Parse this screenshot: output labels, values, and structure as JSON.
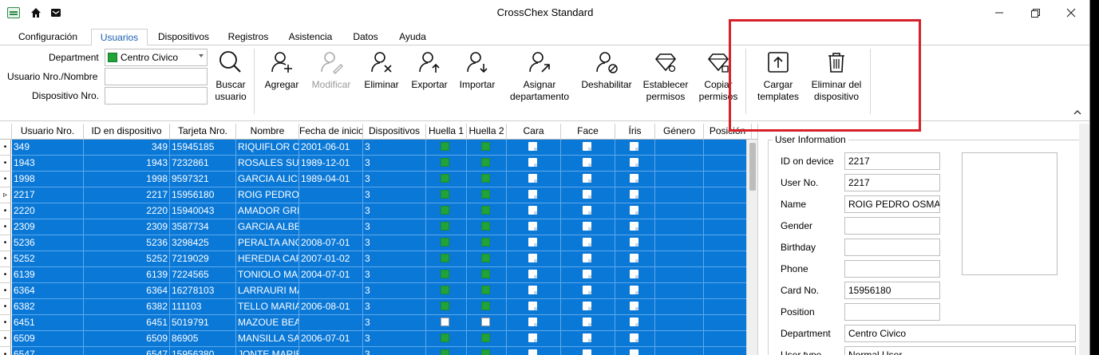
{
  "window": {
    "title": "CrossChex Standard"
  },
  "icons": {
    "app": "app-logo-icon",
    "home": "home-icon",
    "mail": "mail-icon"
  },
  "tabs": [
    "Configuración",
    "Usuarios",
    "Dispositivos",
    "Registros",
    "Asistencia",
    "Datos",
    "Ayuda"
  ],
  "active_tab": "Usuarios",
  "filters": {
    "department_label": "Department",
    "department_value": "Centro Civico",
    "user_label": "Usuario Nro./Nombre",
    "user_value": "",
    "device_label": "Dispositivo Nro.",
    "device_value": ""
  },
  "toolbar": {
    "search": "Buscar\nusuario",
    "add": "Agregar",
    "modify": "Modificar",
    "delete": "Eliminar",
    "export": "Exportar",
    "import": "Importar",
    "assign_dept": "Asignar\ndepartamento",
    "disable": "Deshabilitar",
    "set_perms": "Establecer\npermisos",
    "copy_perms": "Copiar\npermisos",
    "load_templates": "Cargar\ntemplates",
    "delete_from_device": "Eliminar del\ndispositivo"
  },
  "colors": {
    "selection": "#0a78d7",
    "fingerprint_on": "#22a33a",
    "highlight": "#d8202a"
  },
  "grid": {
    "columns": [
      "Usuario Nro.",
      "ID en dispositivo",
      "Tarjeta Nro.",
      "Nombre",
      "Fecha de inicio",
      "Dispositivos",
      "Huella 1",
      "Huella 2",
      "Cara",
      "Face",
      "Íris",
      "Género",
      "Posición"
    ],
    "rows": [
      {
        "user_no": "349",
        "device_id": "349",
        "card": "15945185",
        "name": "RIQUIFLOR CLAUDIA",
        "start": "2001-06-01",
        "devices": "3",
        "f1": true,
        "f2": true
      },
      {
        "user_no": "1943",
        "device_id": "1943",
        "card": "7232861",
        "name": "ROSALES SUSANA",
        "start": "1989-12-01",
        "devices": "3",
        "f1": true,
        "f2": true
      },
      {
        "user_no": "1998",
        "device_id": "1998",
        "card": "9597321",
        "name": "GARCIA ALICIA",
        "start": "1989-04-01",
        "devices": "3",
        "f1": true,
        "f2": true
      },
      {
        "user_no": "2217",
        "device_id": "2217",
        "card": "15956180",
        "name": "ROIG PEDRO OSMAR",
        "start": "",
        "devices": "3",
        "f1": true,
        "f2": true
      },
      {
        "user_no": "2220",
        "device_id": "2220",
        "card": "15940043",
        "name": "AMADOR GRISELDA",
        "start": "",
        "devices": "3",
        "f1": true,
        "f2": true
      },
      {
        "user_no": "2309",
        "device_id": "2309",
        "card": "3587734",
        "name": "GARCIA ALBERTO",
        "start": "",
        "devices": "3",
        "f1": true,
        "f2": true
      },
      {
        "user_no": "5236",
        "device_id": "5236",
        "card": "3298425",
        "name": "PERALTA ANGELA",
        "start": "2008-07-01",
        "devices": "3",
        "f1": true,
        "f2": true
      },
      {
        "user_no": "5252",
        "device_id": "5252",
        "card": "7219029",
        "name": "HEREDIA CARLOS",
        "start": "2007-01-02",
        "devices": "3",
        "f1": true,
        "f2": true
      },
      {
        "user_no": "6139",
        "device_id": "6139",
        "card": "7224565",
        "name": "TONIOLO MARIA",
        "start": "2004-07-01",
        "devices": "3",
        "f1": true,
        "f2": true
      },
      {
        "user_no": "6364",
        "device_id": "6364",
        "card": "16278103",
        "name": "LARRAURI MARTA",
        "start": "",
        "devices": "3",
        "f1": true,
        "f2": true
      },
      {
        "user_no": "6382",
        "device_id": "6382",
        "card": "111103",
        "name": "TELLO MARIA",
        "start": "2006-08-01",
        "devices": "3",
        "f1": true,
        "f2": true
      },
      {
        "user_no": "6451",
        "device_id": "6451",
        "card": "5019791",
        "name": "MAZOUE BEATRIZ",
        "start": "",
        "devices": "3",
        "f1": false,
        "f2": false
      },
      {
        "user_no": "6509",
        "device_id": "6509",
        "card": "86905",
        "name": "MANSILLA SARA",
        "start": "2006-07-01",
        "devices": "3",
        "f1": true,
        "f2": true
      },
      {
        "user_no": "6547",
        "device_id": "6547",
        "card": "15956380",
        "name": "JONTE MARIEL",
        "start": "",
        "devices": "3",
        "f1": true,
        "f2": true
      }
    ]
  },
  "user_info": {
    "title": "User Information",
    "fields": [
      {
        "label": "ID on device",
        "value": "2217"
      },
      {
        "label": "User No.",
        "value": "2217"
      },
      {
        "label": "Name",
        "value": "ROIG PEDRO OSMAR"
      },
      {
        "label": "Gender",
        "value": ""
      },
      {
        "label": "Birthday",
        "value": ""
      },
      {
        "label": "Phone",
        "value": ""
      },
      {
        "label": "Card No.",
        "value": "15956180"
      },
      {
        "label": "Position",
        "value": ""
      },
      {
        "label": "Department",
        "value": "Centro Civico"
      },
      {
        "label": "User type",
        "value": "Normal User"
      }
    ]
  }
}
